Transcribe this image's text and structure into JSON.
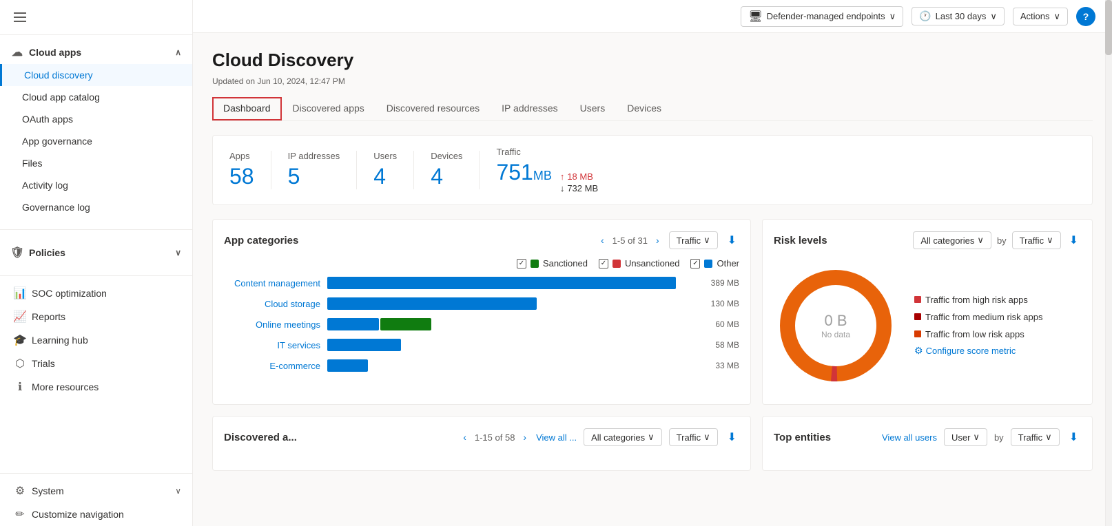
{
  "sidebar": {
    "hamburger_label": "Menu",
    "sections": [
      {
        "label": "Cloud apps",
        "icon": "cloud",
        "expanded": true,
        "items": [
          {
            "label": "Cloud discovery",
            "active": true,
            "indent": true
          },
          {
            "label": "Cloud app catalog",
            "active": false,
            "indent": true
          },
          {
            "label": "OAuth apps",
            "active": false,
            "indent": true
          },
          {
            "label": "App governance",
            "active": false,
            "indent": true
          },
          {
            "label": "Files",
            "active": false,
            "indent": true
          },
          {
            "label": "Activity log",
            "active": false,
            "indent": true
          },
          {
            "label": "Governance log",
            "active": false,
            "indent": true
          }
        ]
      },
      {
        "label": "Policies",
        "icon": "policy",
        "expanded": false,
        "items": []
      }
    ],
    "standalone_items": [
      {
        "label": "SOC optimization",
        "icon": "soc"
      },
      {
        "label": "Reports",
        "icon": "reports"
      },
      {
        "label": "Learning hub",
        "icon": "learning"
      },
      {
        "label": "Trials",
        "icon": "trials"
      },
      {
        "label": "More resources",
        "icon": "more"
      }
    ],
    "bottom_items": [
      {
        "label": "System",
        "icon": "system",
        "has_chevron": true
      },
      {
        "label": "Customize navigation",
        "icon": "customize"
      }
    ]
  },
  "topbar": {
    "endpoint_label": "Defender-managed endpoints",
    "timerange_label": "Last 30 days",
    "actions_label": "Actions",
    "help_label": "?"
  },
  "page": {
    "title": "Cloud Discovery",
    "updated_text": "Updated on Jun 10, 2024, 12:47 PM"
  },
  "tabs": [
    {
      "label": "Dashboard",
      "active": true
    },
    {
      "label": "Discovered apps",
      "active": false
    },
    {
      "label": "Discovered resources",
      "active": false
    },
    {
      "label": "IP addresses",
      "active": false
    },
    {
      "label": "Users",
      "active": false
    },
    {
      "label": "Devices",
      "active": false
    }
  ],
  "stats": [
    {
      "label": "Apps",
      "value": "58"
    },
    {
      "label": "IP addresses",
      "value": "5"
    },
    {
      "label": "Users",
      "value": "4"
    },
    {
      "label": "Devices",
      "value": "4"
    }
  ],
  "traffic": {
    "label": "Traffic",
    "main_value": "751",
    "main_unit": "MB",
    "upload": "18 MB",
    "download": "732 MB"
  },
  "app_categories": {
    "title": "App categories",
    "pagination": "1-5 of 31",
    "dropdown_label": "Traffic",
    "legend": [
      {
        "label": "Sanctioned",
        "color": "#107c10"
      },
      {
        "label": "Unsanctioned",
        "color": "#d13438"
      },
      {
        "label": "Other",
        "color": "#0078d4"
      }
    ],
    "bars": [
      {
        "label": "Content management",
        "value": "389 MB",
        "blue_pct": 95,
        "green_pct": 0
      },
      {
        "label": "Cloud storage",
        "value": "130 MB",
        "blue_pct": 60,
        "green_pct": 0
      },
      {
        "label": "Online meetings",
        "value": "60 MB",
        "blue_pct": 20,
        "green_pct": 20
      },
      {
        "label": "IT services",
        "value": "58 MB",
        "blue_pct": 22,
        "green_pct": 0
      },
      {
        "label": "E-commerce",
        "value": "33 MB",
        "blue_pct": 12,
        "green_pct": 0
      }
    ]
  },
  "risk_levels": {
    "title": "Risk levels",
    "categories_dropdown": "All categories",
    "by_label": "by",
    "traffic_dropdown": "Traffic",
    "donut_value": "0 B",
    "donut_label": "No data",
    "legend": [
      {
        "label": "Traffic from high risk apps",
        "color": "#d13438"
      },
      {
        "label": "Traffic from medium risk apps",
        "color": "#a80000"
      },
      {
        "label": "Traffic from low risk apps",
        "color": "#d83b01"
      }
    ],
    "configure_label": "Configure score metric"
  },
  "bottom_left": {
    "title": "Discovered a...",
    "pagination": "1-15 of 58",
    "view_all_label": "View all ...",
    "categories_dropdown": "All categories",
    "traffic_dropdown": "Traffic"
  },
  "bottom_right": {
    "title": "Top entities",
    "view_all_label": "View all users",
    "user_dropdown": "User",
    "by_label": "by",
    "traffic_dropdown": "Traffic"
  }
}
